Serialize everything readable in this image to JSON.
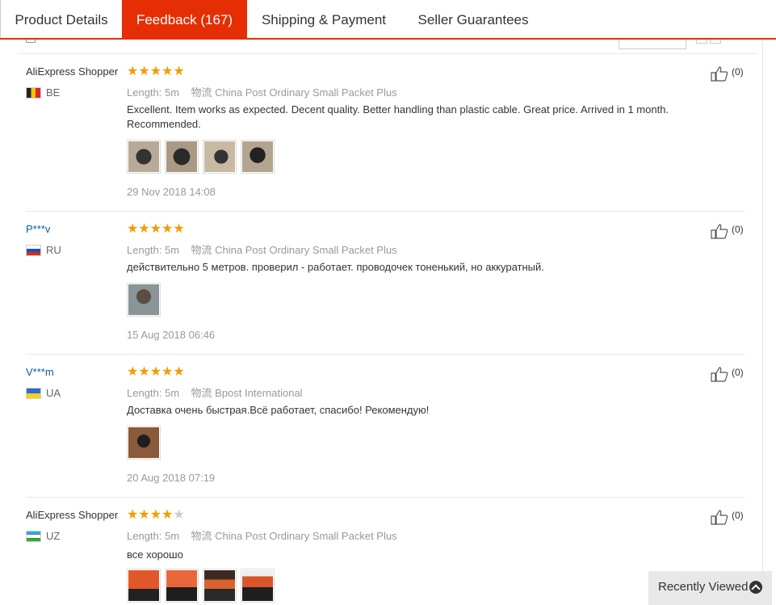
{
  "tabs": [
    {
      "label": "Product Details",
      "active": false
    },
    {
      "label": "Feedback (167)",
      "active": true
    },
    {
      "label": "Shipping & Payment",
      "active": false
    },
    {
      "label": "Seller Guarantees",
      "active": false
    }
  ],
  "colors": {
    "accent": "#e62e04",
    "star": "#f79a00",
    "link": "#0060b3"
  },
  "reviews": [
    {
      "user": "AliExpress Shopper",
      "country": "BE",
      "rating": 5,
      "length_label": "Length:",
      "length_value": "5m",
      "logistics_label": "物流",
      "logistics_value": "China Post Ordinary Small Packet Plus",
      "text": "Excellent. Item works as expected. Decent quality. Better handling than plastic cable. Great price. Arrived in 1 month. Recommended.",
      "date": "29 Nov 2018 14:08",
      "helpful": "(0)"
    },
    {
      "user": "P***v",
      "country": "RU",
      "rating": 5,
      "length_label": "Length:",
      "length_value": "5m",
      "logistics_label": "物流",
      "logistics_value": "China Post Ordinary Small Packet Plus",
      "text": "действительно 5 метров. проверил - работает. проводочек тоненький, но аккуратный.",
      "date": "15 Aug 2018 06:46",
      "helpful": "(0)"
    },
    {
      "user": "V***m",
      "country": "UA",
      "rating": 5,
      "length_label": "Length:",
      "length_value": "5m",
      "logistics_label": "物流",
      "logistics_value": "Bpost International",
      "text": "Доставка очень быстрая.Всё работает, спасибо! Рекомендую!",
      "date": "20 Aug 2018 07:19",
      "helpful": "(0)"
    },
    {
      "user": "AliExpress Shopper",
      "country": "UZ",
      "rating": 4,
      "length_label": "Length:",
      "length_value": "5m",
      "logistics_label": "物流",
      "logistics_value": "China Post Ordinary Small Packet Plus",
      "text": "все хорошо",
      "date": "",
      "helpful": "(0)"
    }
  ],
  "recently_viewed": {
    "label": "Recently Viewed",
    "icon": "chevron-up-circle-icon"
  }
}
